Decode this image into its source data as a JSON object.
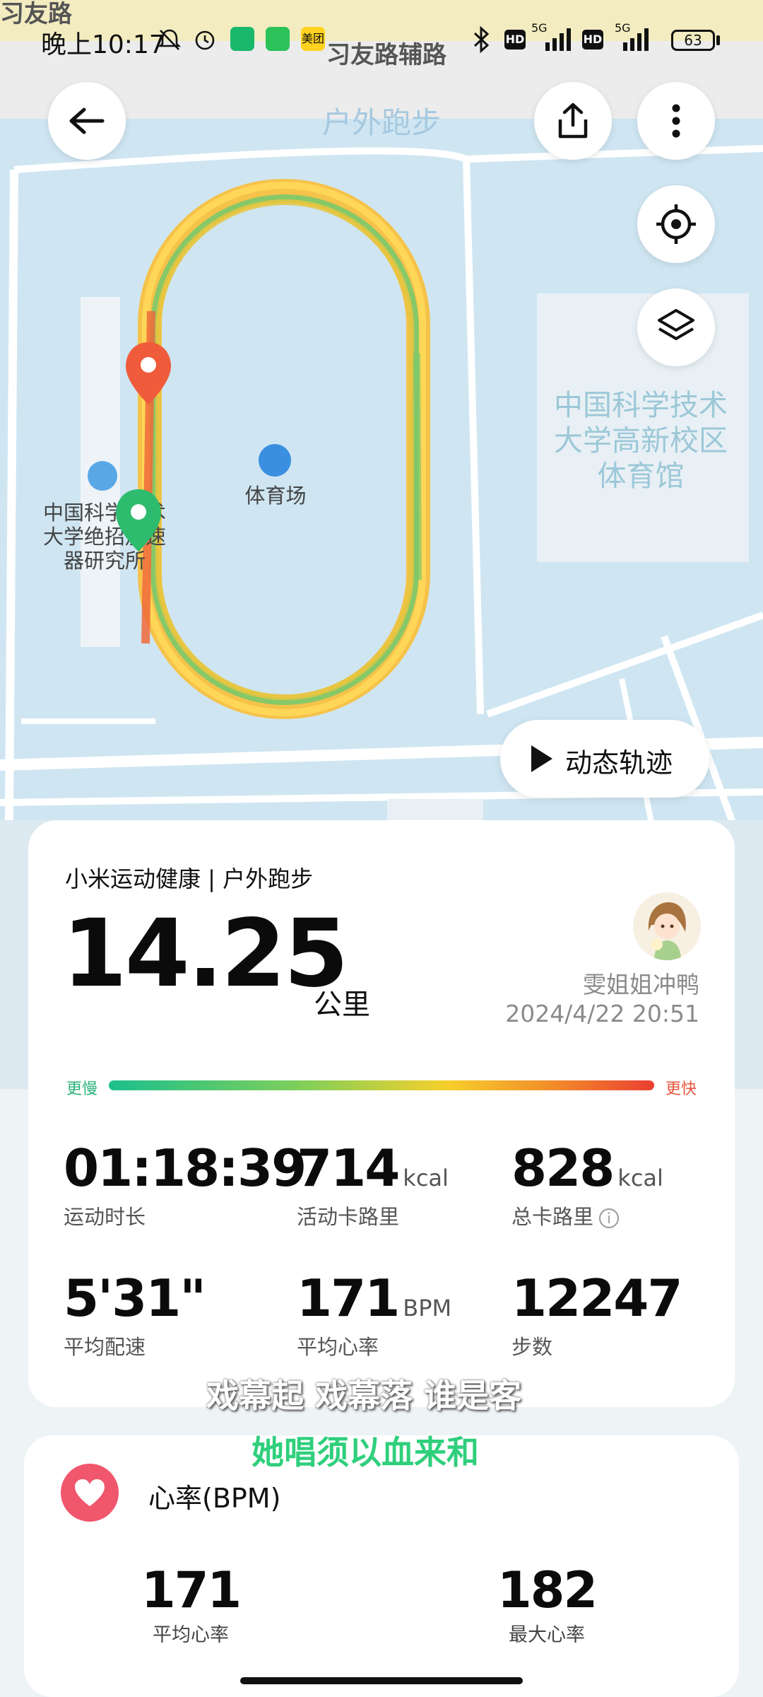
{
  "status_bar": {
    "time": "晚上10:17",
    "network": "5G",
    "hd": "HD",
    "battery": "63",
    "app_icon_meituan": "美团"
  },
  "map": {
    "top_road": "习友路",
    "aux_road": "习友路辅路",
    "stadium_label": "体育场",
    "institute_label": "中国科学技术大学绝招加速器研究所",
    "gym_label": "中国科学技术大学高新校区体育馆",
    "start_color": "#2dbb6e",
    "end_color": "#ef5b3b"
  },
  "header": {
    "title": "户外跑步"
  },
  "controls": {
    "dynamic_track_label": "动态轨迹"
  },
  "summary": {
    "app_line": "小米运动健康 | 户外跑步",
    "distance": "14.25",
    "distance_unit": "公里",
    "user_name": "雯姐姐冲鸭",
    "date_time": "2024/4/22 20:51",
    "pace_slow_label": "更慢",
    "pace_fast_label": "更快",
    "stats": [
      {
        "value": "01:18:39",
        "unit": "",
        "label": "运动时长"
      },
      {
        "value": "714",
        "unit": "kcal",
        "label": "活动卡路里"
      },
      {
        "value": "828",
        "unit": "kcal",
        "label": "总卡路里"
      },
      {
        "value": "5'31\"",
        "unit": "",
        "label": "平均配速"
      },
      {
        "value": "171",
        "unit": "BPM",
        "label": "平均心率"
      },
      {
        "value": "12247",
        "unit": "",
        "label": "步数"
      }
    ]
  },
  "lyrics": {
    "line1": "戏幕起 戏幕落 谁是客",
    "line2": "她唱须以血来和"
  },
  "heart_rate": {
    "title": "心率(BPM)",
    "avg_value": "171",
    "avg_label": "平均心率",
    "max_value": "182",
    "max_label": "最大心率"
  }
}
